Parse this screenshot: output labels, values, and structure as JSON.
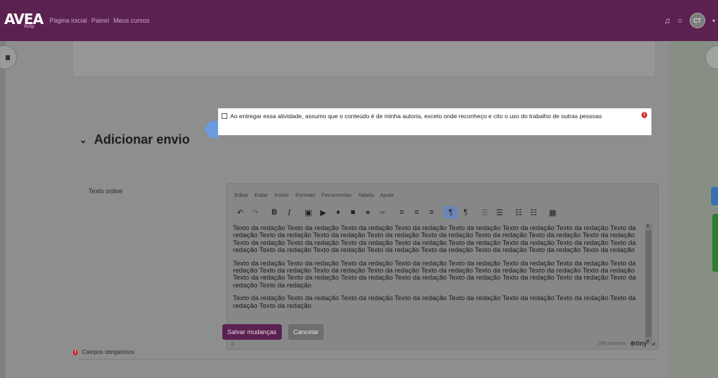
{
  "navbar": {
    "logo_text": "AVEA",
    "logo_sub": "IfcGp",
    "links": [
      "Página inicial",
      "Painel",
      "Meus cursos"
    ],
    "icons": [
      "bell-icon",
      "chat-icon"
    ],
    "avatar_initials": "CT"
  },
  "section": {
    "title": "Adicionar envio"
  },
  "statement": {
    "text": "Ao entregar essa atividade, assumo que o conteúdo é de minha autoria, exceto onde reconheço e cito o uso do trabalho de outras pessoas",
    "required_icon": "!"
  },
  "field": {
    "label": "Texto online"
  },
  "editor": {
    "menu": [
      "Editar",
      "Exibir",
      "Inserir",
      "Formato",
      "Ferramentas",
      "Tabela",
      "Ajuda"
    ],
    "paragraphs": [
      "Texto da redação Texto da redação Texto da redação Texto da redação Texto da redação Texto da redação Texto da redação Texto da redação Texto da redação Texto da redação Texto da redação Texto da redação Texto da redação Texto da redação Texto da redação Texto da redação Texto da redação Texto da redação Texto da redação Texto da redação Texto da redação Texto da redação Texto da redação Texto da redação Texto da redação Texto da redação Texto da redação Texto da redação Texto da redação Texto da redação",
      "Texto da redação Texto da redação Texto da redação Texto da redação Texto da redação Texto da redação Texto da redação Texto da redação Texto da redação Texto da redação Texto da redação Texto da redação Texto da redação Texto da redação Texto da redação Texto da redação Texto da redação Texto da redação Texto da redação Texto da redação Texto da redação Texto da redação Texto da redação Texto da redação",
      "Texto da redação Texto da redação Texto da redação Texto da redação Texto da redação Texto da redação Texto da redação Texto da redação Texto da redação"
    ],
    "path": "p",
    "word_count": "189 palavras",
    "brand": "tiny"
  },
  "buttons": {
    "save": "Salvar mudanças",
    "cancel": "Cancelar"
  },
  "footer": {
    "required_note": "Campos obrigatórios"
  }
}
